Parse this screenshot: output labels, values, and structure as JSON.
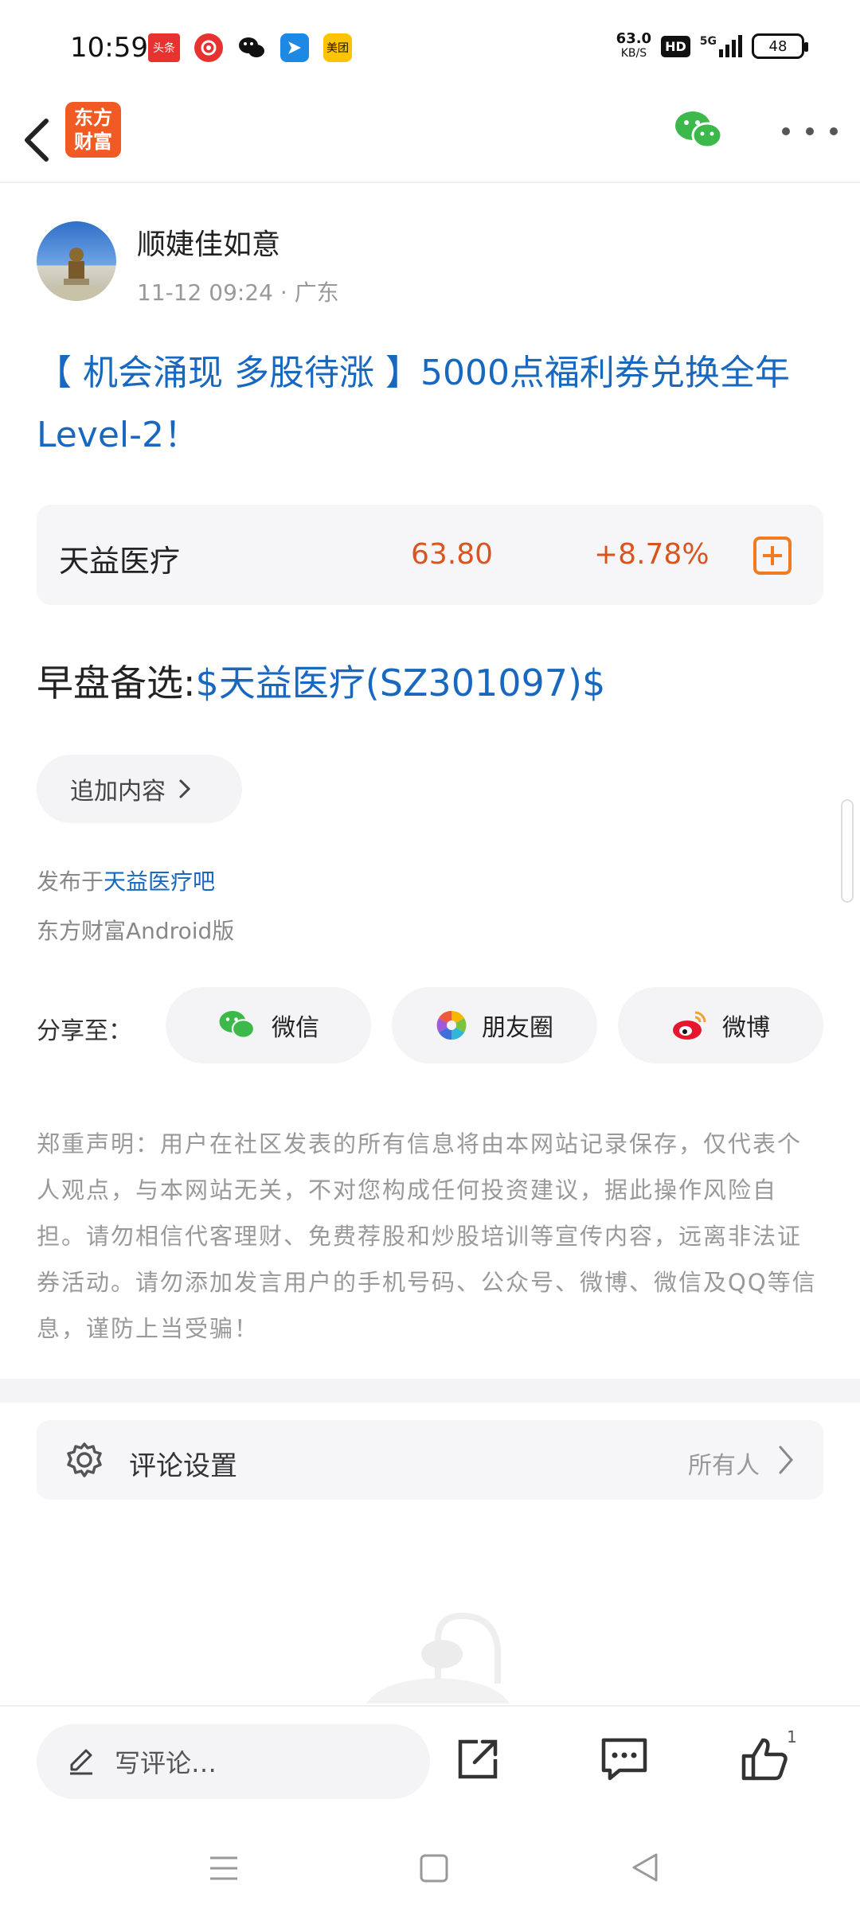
{
  "status_bar": {
    "time": "10:59",
    "apps": [
      {
        "name": "头条",
        "color": "#e8322f"
      },
      {
        "name": "",
        "color": "#e8322f"
      },
      {
        "name": "",
        "color": "#ffffff"
      },
      {
        "name": "",
        "color": "#1e88e5"
      },
      {
        "name": "美团",
        "color": "#ffc300"
      }
    ],
    "net_speed": "63.0",
    "net_unit": "KB/S",
    "hd": "HD",
    "network": "5G",
    "battery": "48"
  },
  "header": {
    "logo_line1": "东方",
    "logo_line2": "财富"
  },
  "author": {
    "name": "顺婕佳如意",
    "meta": "11-12 09:24 · 广东"
  },
  "post": {
    "title": "【 机会涌现 多股待涨 】5000点福利券兑换全年Level-2！",
    "body_prefix": "早盘备选:",
    "body_link": "$天益医疗(SZ301097)$"
  },
  "stock": {
    "name": "天益医疗",
    "price": "63.80",
    "change": "+8.78%"
  },
  "append": {
    "label": "追加内容"
  },
  "meta": {
    "posted_prefix": "发布于",
    "bar_name": "天益医疗吧",
    "platform": "东方财富Android版"
  },
  "share": {
    "label": "分享至：",
    "wechat": "微信",
    "moments": "朋友圈",
    "weibo": "微博"
  },
  "disclaimer": "郑重声明：用户在社区发表的所有信息将由本网站记录保存，仅代表个人观点，与本网站无关，不对您构成任何投资建议，据此操作风险自担。请勿相信代客理财、免费荐股和炒股培训等宣传内容，远离非法证券活动。请勿添加发言用户的手机号码、公众号、微博、微信及QQ等信息，谨防上当受骗！",
  "comment_setting": {
    "label": "评论设置",
    "value": "所有人"
  },
  "action_bar": {
    "comment_placeholder": "写评论…",
    "like_count": "1"
  },
  "colors": {
    "brand": "#f15a22",
    "link": "#1868c0",
    "up": "#d9541e"
  }
}
